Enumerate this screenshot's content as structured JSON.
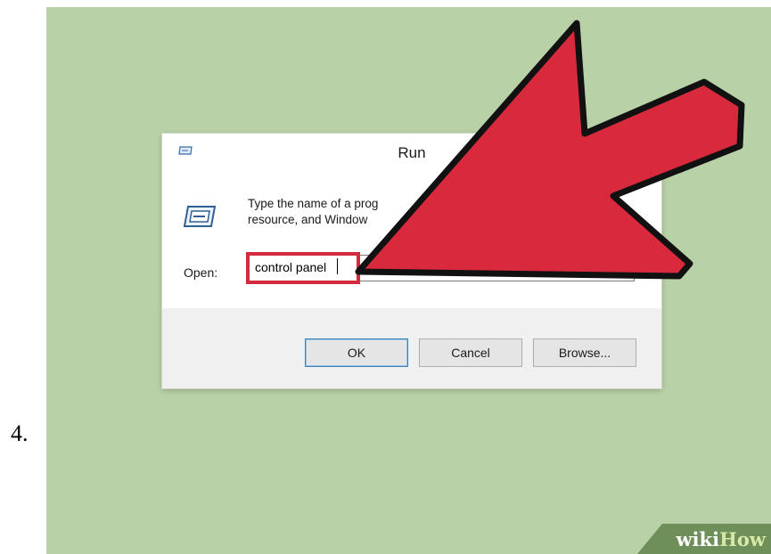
{
  "step": {
    "number": "4."
  },
  "dialog": {
    "title": "Run",
    "description_line1": "Type the name of a prog",
    "description_line2": "resource, and Window",
    "open_label": "Open:",
    "open_value": "control panel",
    "buttons": {
      "ok": "OK",
      "cancel": "Cancel",
      "browse": "Browse..."
    },
    "icons": {
      "title": "run-icon",
      "body": "run-icon"
    }
  },
  "annotation": {
    "arrow_color": "#d82a3c",
    "highlight_color": "#d22b3c"
  },
  "watermark": {
    "part1": "wiki",
    "part2": "How"
  },
  "colors": {
    "background": "#b9d1a6",
    "dialog_footer": "#f0f0f0",
    "watermark_band": "#6e8f59"
  }
}
